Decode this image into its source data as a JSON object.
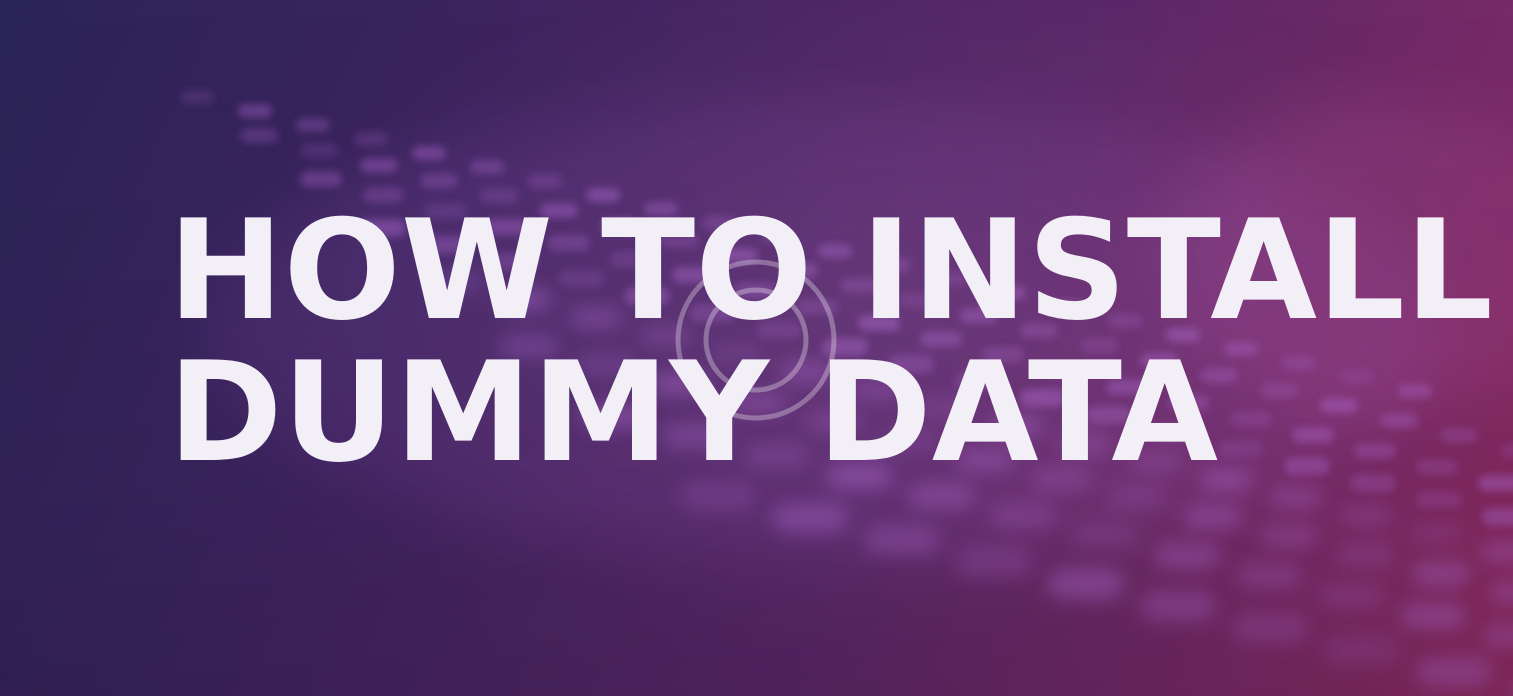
{
  "hero": {
    "title_lines": [
      "HOW TO INSTALL",
      "DUMMY DATA"
    ],
    "background_icon": "blurred-keyboard-image",
    "overlay_icon": "play-circle-icon"
  },
  "colors": {
    "gradient_start": "#2a2456",
    "gradient_mid": "#5a2768",
    "gradient_end": "#8c2a5f",
    "title_text": "#f2eff6",
    "key_glow": "#b36ad6"
  }
}
